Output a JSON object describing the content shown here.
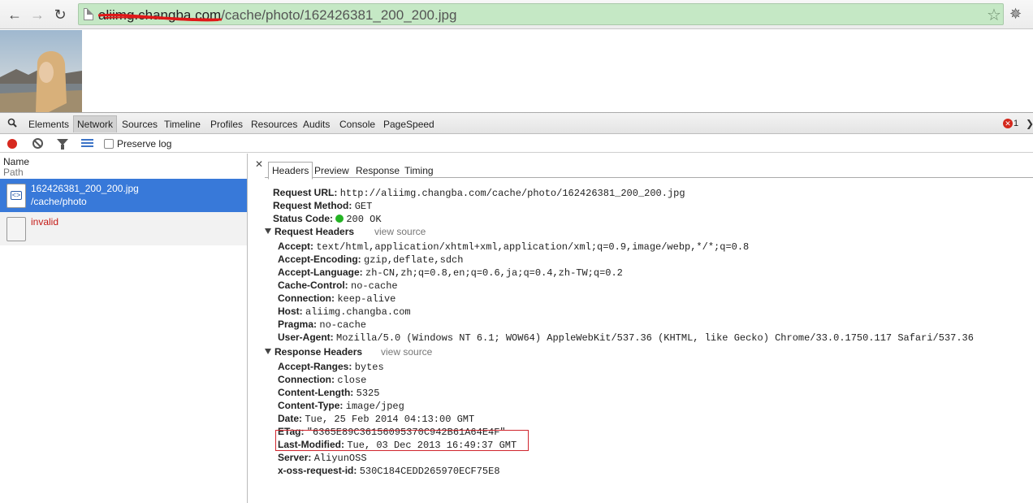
{
  "browser": {
    "url_host": "aliimg.changba.com",
    "url_path": "/cache/photo/162426381_200_200.jpg"
  },
  "devtools": {
    "tabs": [
      "Elements",
      "Network",
      "Sources",
      "Timeline",
      "Profiles",
      "Resources",
      "Audits",
      "Console",
      "PageSpeed"
    ],
    "active_tab": "Network",
    "error_count": "1",
    "preserve_log_label": "Preserve log",
    "columns": {
      "name": "Name",
      "path": "Path"
    },
    "requests": [
      {
        "name": "162426381_200_200.jpg",
        "path": "/cache/photo",
        "selected": true
      },
      {
        "name": "invalid",
        "path": "",
        "selected": false
      }
    ],
    "detail_tabs": [
      "Headers",
      "Preview",
      "Response",
      "Timing"
    ],
    "active_detail_tab": "Headers",
    "general": [
      {
        "key": "Request URL:",
        "value": "http://aliimg.changba.com/cache/photo/162426381_200_200.jpg"
      },
      {
        "key": "Request Method:",
        "value": "GET"
      },
      {
        "key": "Status Code:",
        "value": "200 OK"
      }
    ],
    "request_headers_title": "Request Headers",
    "response_headers_title": "Response Headers",
    "view_source_label": "view source",
    "request_headers": [
      {
        "key": "Accept:",
        "value": "text/html,application/xhtml+xml,application/xml;q=0.9,image/webp,*/*;q=0.8"
      },
      {
        "key": "Accept-Encoding:",
        "value": "gzip,deflate,sdch"
      },
      {
        "key": "Accept-Language:",
        "value": "zh-CN,zh;q=0.8,en;q=0.6,ja;q=0.4,zh-TW;q=0.2"
      },
      {
        "key": "Cache-Control:",
        "value": "no-cache"
      },
      {
        "key": "Connection:",
        "value": "keep-alive"
      },
      {
        "key": "Host:",
        "value": "aliimg.changba.com"
      },
      {
        "key": "Pragma:",
        "value": "no-cache"
      },
      {
        "key": "User-Agent:",
        "value": "Mozilla/5.0 (Windows NT 6.1; WOW64) AppleWebKit/537.36 (KHTML, like Gecko) Chrome/33.0.1750.117 Safari/537.36"
      }
    ],
    "response_headers": [
      {
        "key": "Accept-Ranges:",
        "value": "bytes"
      },
      {
        "key": "Connection:",
        "value": "close"
      },
      {
        "key": "Content-Length:",
        "value": "5325"
      },
      {
        "key": "Content-Type:",
        "value": "image/jpeg"
      },
      {
        "key": "Date:",
        "value": "Tue, 25 Feb 2014 04:13:00 GMT"
      },
      {
        "key": "ETag:",
        "value": "\"6365E89C36156095370C942B61A64E4F\""
      },
      {
        "key": "Last-Modified:",
        "value": "Tue, 03 Dec 2013 16:49:37 GMT"
      },
      {
        "key": "Server:",
        "value": "AliyunOSS"
      },
      {
        "key": "x-oss-request-id:",
        "value": "530C184CEDD265970ECF75E8"
      }
    ]
  },
  "icons": {
    "back": "back-arrow-icon",
    "forward": "forward-arrow-icon",
    "reload": "reload-icon",
    "bookmark": "star-icon",
    "extension": "bug-icon",
    "record": "record-icon",
    "clear": "clear-icon",
    "filter": "filter-icon",
    "view": "list-view-icon",
    "close": "close-icon",
    "status_dot": "status-ok-icon"
  },
  "colors": {
    "omnibox_bg": "#c5e8c5",
    "selected_row": "#3879d9",
    "record_red": "#d7291f",
    "status_ok": "#24b324",
    "highlight": "#d0262e"
  }
}
